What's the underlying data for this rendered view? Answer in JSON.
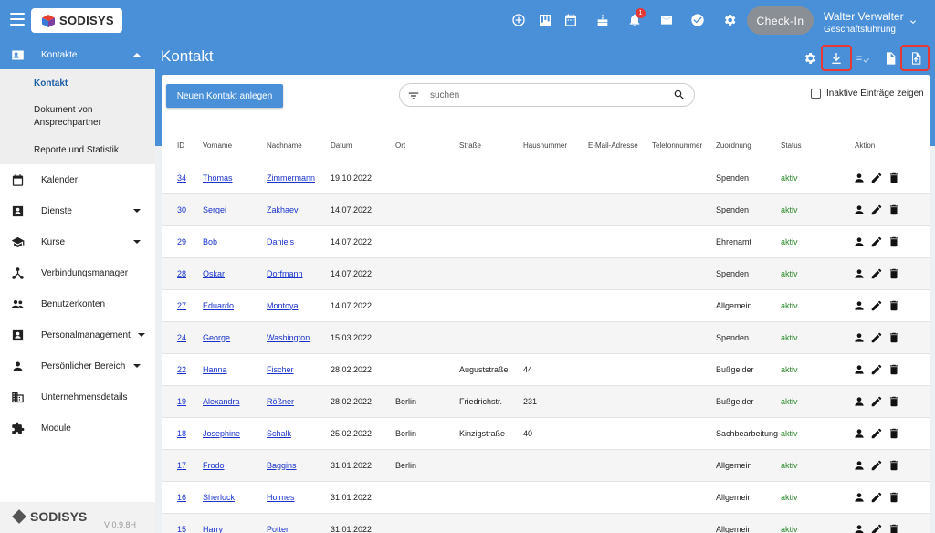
{
  "header": {
    "brand": "SODISYS",
    "notification_count": "1",
    "checkin_label": "Check-In",
    "user_name": "Walter Verwalter",
    "user_role": "Geschäftsführung",
    "icons": [
      "add-circle-icon",
      "kanban-icon",
      "calendar-icon",
      "cake-icon",
      "bell-icon",
      "mail-icon",
      "check-circle-icon",
      "gear-icon"
    ]
  },
  "sidebar": {
    "group_label": "Kontakte",
    "sub_items": [
      "Kontakt",
      "Dokument von Ansprechpartner",
      "Reporte und Statistik"
    ],
    "items": [
      {
        "label": "Kalender",
        "icon": "calendar-icon"
      },
      {
        "label": "Dienste",
        "icon": "badge-icon"
      },
      {
        "label": "Kurse",
        "icon": "school-icon"
      },
      {
        "label": "Verbindungsmanager",
        "icon": "network-icon"
      },
      {
        "label": "Benutzerkonten",
        "icon": "people-icon"
      },
      {
        "label": "Personalmanagement",
        "icon": "contact-card-icon"
      },
      {
        "label": "Persönlicher Bereich",
        "icon": "person-icon"
      },
      {
        "label": "Unternehmensdetails",
        "icon": "building-icon"
      },
      {
        "label": "Module",
        "icon": "puzzle-icon"
      }
    ],
    "footer_brand": "SODISYS",
    "version": "V 0.9.8H"
  },
  "page": {
    "title": "Kontakt",
    "new_button": "Neuen Kontakt anlegen",
    "search_placeholder": "suchen",
    "inactive_label": "Inaktive Einträge zeigen"
  },
  "accent": "#4a90d9",
  "status_color": "#2e8b2e",
  "table": {
    "columns": [
      "ID",
      "Vorname",
      "Nachname",
      "Datum",
      "Ort",
      "Straße",
      "Hausnummer",
      "E-Mail-Adresse",
      "Telefonnummer",
      "Zuordnung",
      "Status",
      "Aktion"
    ],
    "rows": [
      {
        "id": "34",
        "first": "Thomas",
        "last": "Zimmermann",
        "date": "19.10.2022",
        "city": "",
        "street": "",
        "no": "",
        "email": "",
        "phone": "",
        "assign": "Spenden",
        "status": "aktiv"
      },
      {
        "id": "30",
        "first": "Sergei",
        "last": "Zakhaev",
        "date": "14.07.2022",
        "city": "",
        "street": "",
        "no": "",
        "email": "",
        "phone": "",
        "assign": "Spenden",
        "status": "aktiv"
      },
      {
        "id": "29",
        "first": "Bob",
        "last": "Daniels",
        "date": "14.07.2022",
        "city": "",
        "street": "",
        "no": "",
        "email": "",
        "phone": "",
        "assign": "Ehrenamt",
        "status": "aktiv"
      },
      {
        "id": "28",
        "first": "Oskar",
        "last": "Dorfmann",
        "date": "14.07.2022",
        "city": "",
        "street": "",
        "no": "",
        "email": "",
        "phone": "",
        "assign": "Spenden",
        "status": "aktiv"
      },
      {
        "id": "27",
        "first": "Eduardo",
        "last": "Montoya",
        "date": "14.07.2022",
        "city": "",
        "street": "",
        "no": "",
        "email": "",
        "phone": "",
        "assign": "Allgemein",
        "status": "aktiv"
      },
      {
        "id": "24",
        "first": "George",
        "last": "Washington",
        "date": "15.03.2022",
        "city": "",
        "street": "",
        "no": "",
        "email": "",
        "phone": "",
        "assign": "Spenden",
        "status": "aktiv"
      },
      {
        "id": "22",
        "first": "Hanna",
        "last": "Fischer",
        "date": "28.02.2022",
        "city": "",
        "street": "Auguststraße",
        "no": "44",
        "email": "",
        "phone": "",
        "assign": "Bußgelder",
        "status": "aktiv"
      },
      {
        "id": "19",
        "first": "Alexandra",
        "last": "Rößner",
        "date": "28.02.2022",
        "city": "Berlin",
        "street": "Friedrichstr.",
        "no": "231",
        "email": "",
        "phone": "",
        "assign": "Bußgelder",
        "status": "aktiv"
      },
      {
        "id": "18",
        "first": "Josephine",
        "last": "Schalk",
        "date": "25.02.2022",
        "city": "Berlin",
        "street": "Kinzigstraße",
        "no": "40",
        "email": "",
        "phone": "",
        "assign": "Sachbearbeitung",
        "status": "aktiv"
      },
      {
        "id": "17",
        "first": "Frodo",
        "last": "Baggins",
        "date": "31.01.2022",
        "city": "Berlin",
        "street": "",
        "no": "",
        "email": "",
        "phone": "",
        "assign": "Allgemein",
        "status": "aktiv"
      },
      {
        "id": "16",
        "first": "Sherlock",
        "last": "Holmes",
        "date": "31.01.2022",
        "city": "",
        "street": "",
        "no": "",
        "email": "",
        "phone": "",
        "assign": "Allgemein",
        "status": "aktiv"
      },
      {
        "id": "15",
        "first": "Harry",
        "last": "Potter",
        "date": "31.01.2022",
        "city": "",
        "street": "",
        "no": "",
        "email": "",
        "phone": "",
        "assign": "Allgemein",
        "status": "aktiv"
      }
    ]
  }
}
